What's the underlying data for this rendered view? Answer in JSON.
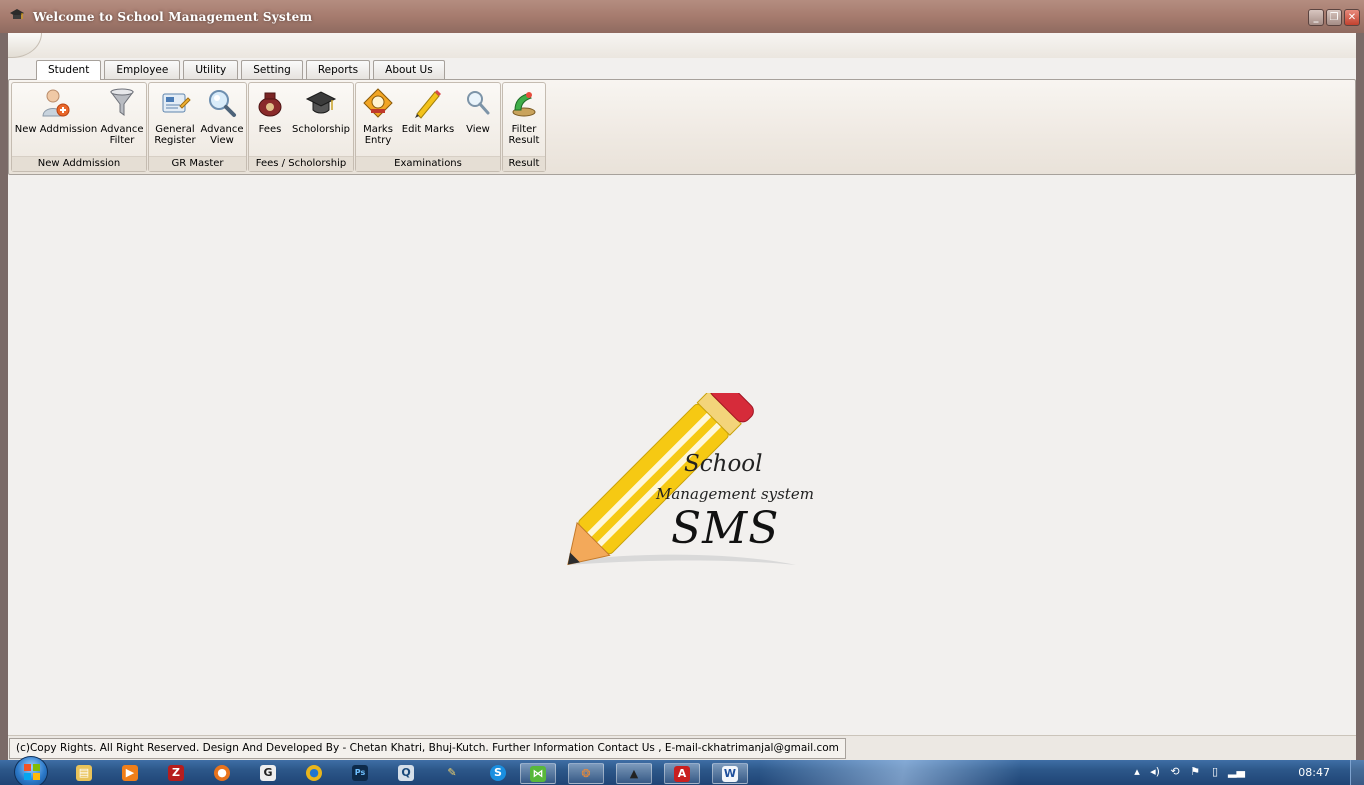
{
  "window": {
    "title": "Welcome to School Management System"
  },
  "tabs": [
    {
      "label": "Student",
      "active": true
    },
    {
      "label": "Employee",
      "active": false
    },
    {
      "label": "Utility",
      "active": false
    },
    {
      "label": "Setting",
      "active": false
    },
    {
      "label": "Reports",
      "active": false
    },
    {
      "label": "About Us",
      "active": false
    }
  ],
  "ribbon": {
    "groups": [
      {
        "label": "New Addmission",
        "buttons": [
          {
            "label": "New Addmission",
            "icon": "add-user-icon"
          },
          {
            "label": "Advance\nFilter",
            "icon": "filter-funnel-icon"
          }
        ]
      },
      {
        "label": "GR Master",
        "buttons": [
          {
            "label": "General\nRegister",
            "icon": "register-edit-icon"
          },
          {
            "label": "Advance\nView",
            "icon": "magnifier-view-icon"
          }
        ]
      },
      {
        "label": "Fees / Scholorship",
        "buttons": [
          {
            "label": "Fees",
            "icon": "fees-bag-icon"
          },
          {
            "label": "Scholorship",
            "icon": "graduation-cap-icon"
          }
        ]
      },
      {
        "label": "Examinations",
        "buttons": [
          {
            "label": "Marks\nEntry",
            "icon": "marks-entry-icon"
          },
          {
            "label": "Edit Marks",
            "icon": "pencil-edit-icon"
          },
          {
            "label": "View",
            "icon": "search-icon"
          }
        ]
      },
      {
        "label": "Result",
        "buttons": [
          {
            "label": "Filter\nResult",
            "icon": "filter-result-icon"
          }
        ]
      }
    ]
  },
  "logo": {
    "line1": "School",
    "line2": "Management system",
    "line3": "SMS"
  },
  "status": {
    "text": "(c)Copy Rights. All Right Reserved.  Design And Developed By - Chetan Khatri,  Bhuj-Kutch.  Further Information Contact Us ,  E-mail-ckhatrimanjal@gmail.com"
  },
  "taskbar": {
    "clock": "08:47",
    "items": [
      "explorer-icon",
      "media-player-icon",
      "filezilla-icon",
      "firefox-icon",
      "g-app-icon",
      "chrome-icon",
      "photoshop-icon",
      "quicktime-icon",
      "paint-icon",
      "skype-icon",
      "visual-studio-icon",
      "media-icon",
      "school-app-icon",
      "acrobat-icon",
      "word-icon"
    ]
  },
  "colors": {
    "titlebar": "#a67b6e",
    "ribbon_bg": "#efe9e2",
    "taskbar": "#2c5789",
    "pencil_yellow": "#f6c913",
    "pencil_eraser": "#d62b3a"
  }
}
